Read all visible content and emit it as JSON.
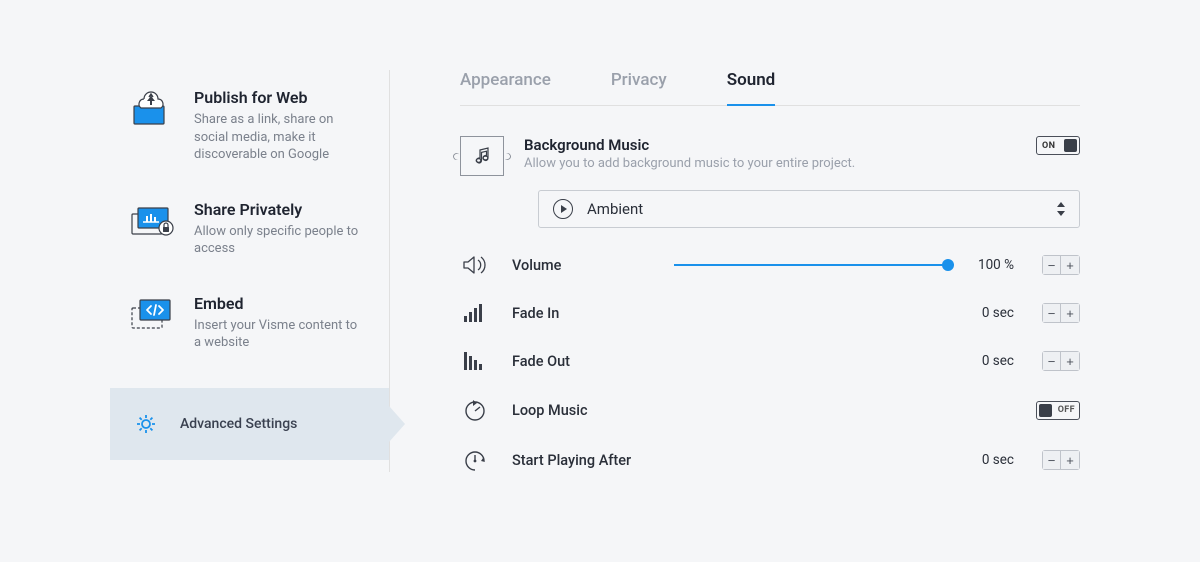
{
  "sidebar": {
    "items": [
      {
        "title": "Publish for Web",
        "desc": "Share as a link, share on social media, make it discoverable on Google"
      },
      {
        "title": "Share Privately",
        "desc": "Allow only specific people to access"
      },
      {
        "title": "Embed",
        "desc": "Insert your Visme content to a website"
      },
      {
        "title": "Advanced Settings",
        "desc": ""
      }
    ]
  },
  "tabs": {
    "appearance": "Appearance",
    "privacy": "Privacy",
    "sound": "Sound"
  },
  "sound": {
    "bg_title": "Background Music",
    "bg_sub": "Allow you to add background music to your entire project.",
    "bg_toggle": "ON",
    "track_select": "Ambient",
    "volume_label": "Volume",
    "volume_value": "100 %",
    "fade_in_label": "Fade In",
    "fade_in_value": "0 sec",
    "fade_out_label": "Fade Out",
    "fade_out_value": "0 sec",
    "loop_label": "Loop Music",
    "loop_toggle": "OFF",
    "start_after_label": "Start Playing After",
    "start_after_value": "0 sec"
  }
}
